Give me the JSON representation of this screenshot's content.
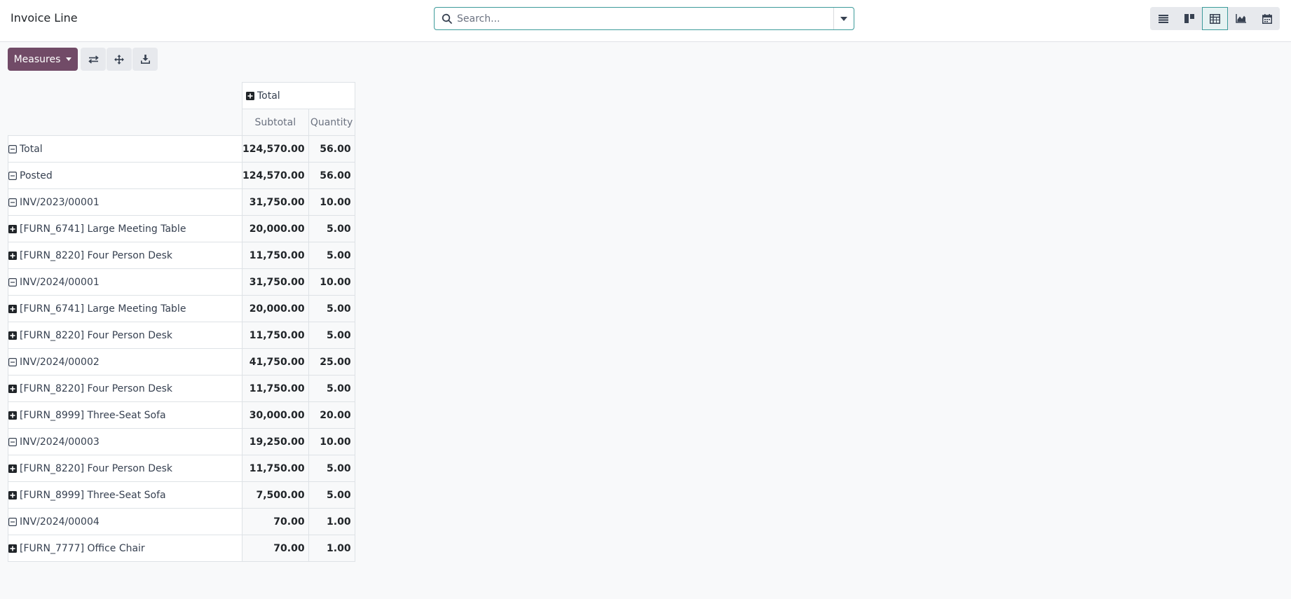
{
  "header": {
    "title": "Invoice Line",
    "search_placeholder": "Search...",
    "views": [
      {
        "name": "list-view-icon",
        "active": false
      },
      {
        "name": "kanban-view-icon",
        "active": false
      },
      {
        "name": "pivot-view-icon",
        "active": true
      },
      {
        "name": "graph-view-icon",
        "active": false
      },
      {
        "name": "calendar-view-icon",
        "active": false
      }
    ]
  },
  "toolbar": {
    "measures_label": "Measures"
  },
  "pivot": {
    "column_header": "Total",
    "measures": [
      "Subtotal",
      "Quantity"
    ],
    "rows": [
      {
        "label": "Total",
        "level": 0,
        "icon": "minus",
        "subtotal": "124,570.00",
        "quantity": "56.00"
      },
      {
        "label": "Posted",
        "level": 1,
        "icon": "minus",
        "subtotal": "124,570.00",
        "quantity": "56.00"
      },
      {
        "label": "INV/2023/00001",
        "level": 2,
        "icon": "minus",
        "subtotal": "31,750.00",
        "quantity": "10.00"
      },
      {
        "label": "[FURN_6741] Large Meeting Table",
        "level": 3,
        "icon": "plus",
        "subtotal": "20,000.00",
        "quantity": "5.00"
      },
      {
        "label": "[FURN_8220] Four Person Desk",
        "level": 3,
        "icon": "plus",
        "subtotal": "11,750.00",
        "quantity": "5.00"
      },
      {
        "label": "INV/2024/00001",
        "level": 2,
        "icon": "minus",
        "subtotal": "31,750.00",
        "quantity": "10.00"
      },
      {
        "label": "[FURN_6741] Large Meeting Table",
        "level": 3,
        "icon": "plus",
        "subtotal": "20,000.00",
        "quantity": "5.00"
      },
      {
        "label": "[FURN_8220] Four Person Desk",
        "level": 3,
        "icon": "plus",
        "subtotal": "11,750.00",
        "quantity": "5.00"
      },
      {
        "label": "INV/2024/00002",
        "level": 2,
        "icon": "minus",
        "subtotal": "41,750.00",
        "quantity": "25.00"
      },
      {
        "label": "[FURN_8220] Four Person Desk",
        "level": 3,
        "icon": "plus",
        "subtotal": "11,750.00",
        "quantity": "5.00"
      },
      {
        "label": "[FURN_8999] Three-Seat Sofa",
        "level": 3,
        "icon": "plus",
        "subtotal": "30,000.00",
        "quantity": "20.00"
      },
      {
        "label": "INV/2024/00003",
        "level": 2,
        "icon": "minus",
        "subtotal": "19,250.00",
        "quantity": "10.00"
      },
      {
        "label": "[FURN_8220] Four Person Desk",
        "level": 3,
        "icon": "plus",
        "subtotal": "11,750.00",
        "quantity": "5.00"
      },
      {
        "label": "[FURN_8999] Three-Seat Sofa",
        "level": 3,
        "icon": "plus",
        "subtotal": "7,500.00",
        "quantity": "5.00"
      },
      {
        "label": "INV/2024/00004",
        "level": 2,
        "icon": "minus",
        "subtotal": "70.00",
        "quantity": "1.00"
      },
      {
        "label": "[FURN_7777] Office Chair",
        "level": 3,
        "icon": "plus",
        "subtotal": "70.00",
        "quantity": "1.00"
      }
    ]
  }
}
